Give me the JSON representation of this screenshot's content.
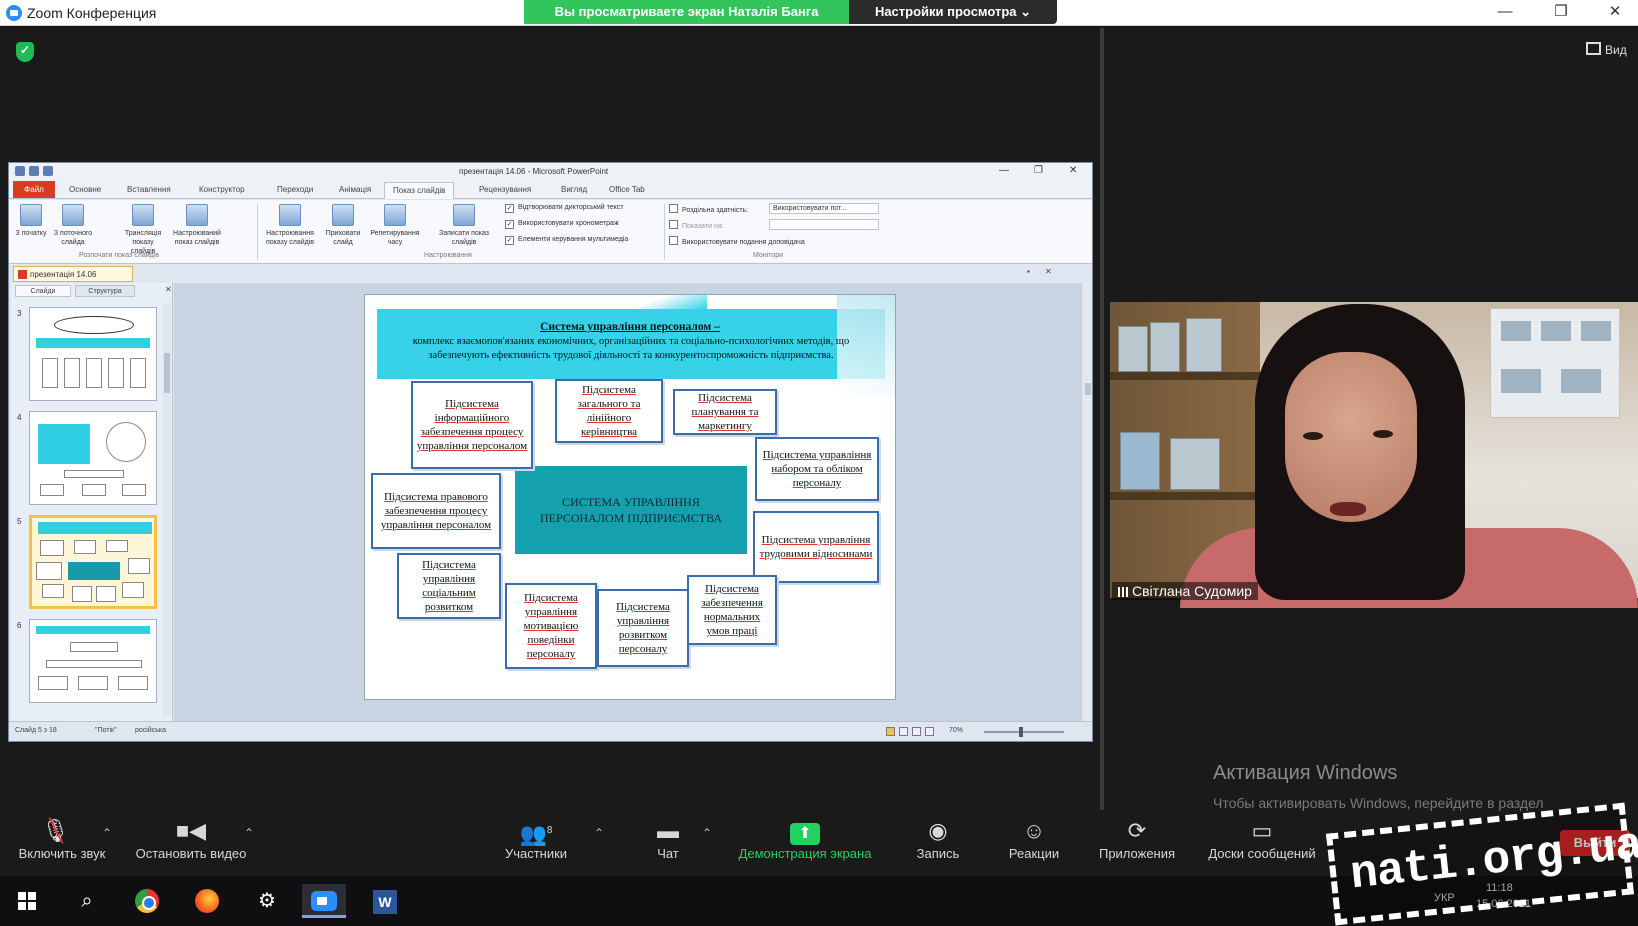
{
  "window": {
    "title": "Zoom Конференция",
    "share_banner": "Вы просматриваете экран Наталія Банга",
    "view_options": "Настройки просмотра ⌄",
    "controls": {
      "minimize": "—",
      "restore": "❐",
      "close": "✕"
    }
  },
  "meeting": {
    "view_label": "Вид",
    "participant_name": "Світлана Судомир",
    "windows_activation": {
      "title": "Активация Windows",
      "text": "Чтобы активировать Windows, перейдите в раздел \"Параметры\"."
    }
  },
  "powerpoint": {
    "title": "презентація 14.06 - Microsoft PowerPoint",
    "tabs": [
      "Файл",
      "Основне",
      "Вставлення",
      "Конструктор",
      "Переходи",
      "Анімація",
      "Показ слайдів",
      "Рецензування",
      "Вигляд",
      "Office Tab"
    ],
    "active_tab": "Показ слайдів",
    "ribbon": {
      "buttons": [
        {
          "label": "З початку"
        },
        {
          "label": "З поточного слайда"
        },
        {
          "label": "Трансляція показу слайдів"
        },
        {
          "label": "Настроюваний показ слайдів"
        },
        {
          "label": "Настроювання показу слайдів"
        },
        {
          "label": "Приховати слайд"
        },
        {
          "label": "Репетирування часу"
        },
        {
          "label": "Записати показ слайдів"
        }
      ],
      "groups": [
        "Розпочати показ слайдів",
        "Настроювання",
        "Монітори"
      ],
      "checkboxes": [
        {
          "label": "Відтворювати дикторський текст",
          "checked": true
        },
        {
          "label": "Використовувати хронометраж",
          "checked": true
        },
        {
          "label": "Елементи керування мультимедіа",
          "checked": true
        },
        {
          "label": "Роздільна здатність:",
          "checked": false
        },
        {
          "label": "Показати на:",
          "checked": false
        },
        {
          "label": "Використовувати подання доповідача",
          "checked": false
        }
      ],
      "resolution_value": "Використовувати пот...",
      "show_on_value": ""
    },
    "doc_tab": "презентація 14.06",
    "thumb_tabs": [
      "Слайди",
      "Структура"
    ],
    "thumbnails": [
      {
        "num": "3"
      },
      {
        "num": "4"
      },
      {
        "num": "5",
        "selected": true
      },
      {
        "num": "6"
      }
    ],
    "status": {
      "slide": "Слайд 5 з 18",
      "theme": "\"Потік\"",
      "lang": "російська",
      "zoom": "70%"
    },
    "slide": {
      "title": "Система управління персоналом",
      "title_dash": " –",
      "description": "комплекс взаємопов'язаних економічних, організаційних та соціально-психологічних методів, що забезпечують ефективність трудової діяльності та конкурентоспроможність підприємства.",
      "center": "СИСТЕМА УПРАВЛІННЯ ПЕРСОНАЛОМ ПІДПРИЄМСТВА",
      "boxes": [
        "Підсистема інформаційного забезпечення процесу управління персоналом",
        "Підсистема загального та лінійного керівництва",
        "Підсистема планування та маркетингу",
        "Підсистема управління набором та обліком персоналу",
        "Підсистема правового забезпечення процесу управління персоналом",
        "Підсистема управління трудовими відносинами",
        "Підсистема управління соціальним розвитком",
        "Підсистема управління мотивацією поведінки персоналу",
        "Підсистема управління розвитком персоналу",
        "Підсистема забезпечення нормальних умов праці"
      ]
    }
  },
  "toolbar": {
    "audio": "Включить звук",
    "video": "Остановить видео",
    "participants": "Участники",
    "participants_count": "8",
    "chat": "Чат",
    "share": "Демонстрация экрана",
    "record": "Запись",
    "reactions": "Реакции",
    "apps": "Приложения",
    "whiteboards": "Доски сообщений",
    "leave": "Выйти"
  },
  "taskbar": {
    "lang": "УКР",
    "time": "11:18",
    "date": "15.06.2021"
  },
  "watermark": "nati.org.ua"
}
